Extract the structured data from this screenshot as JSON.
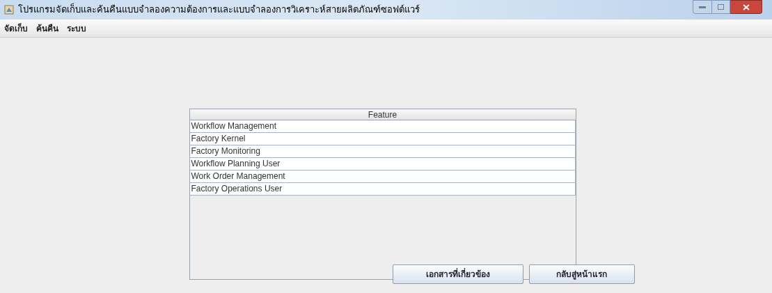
{
  "window": {
    "title": "โปรแกรมจัดเก็บและค้นคืนแบบจำลองความต้องการและแบบจำลองการวิเคราะห์สายผลิตภัณฑ์ซอฟต์แวร์"
  },
  "menu": [
    "จัดเก็บ",
    "ค้นคืน",
    "ระบบ"
  ],
  "table": {
    "columns": [
      "Feature"
    ],
    "rows": [
      {
        "cells": [
          "Workflow Management"
        ]
      },
      {
        "cells": [
          "Factory Kernel"
        ]
      },
      {
        "cells": [
          "Factory Monitoring"
        ]
      },
      {
        "cells": [
          "Workflow Planning User"
        ]
      },
      {
        "cells": [
          "Work Order Management"
        ]
      },
      {
        "cells": [
          "Factory Operations User"
        ]
      }
    ]
  },
  "buttons": [
    "เอกสารที่เกี่ยวข้อง",
    "กลับสู่หน้าแรก"
  ]
}
